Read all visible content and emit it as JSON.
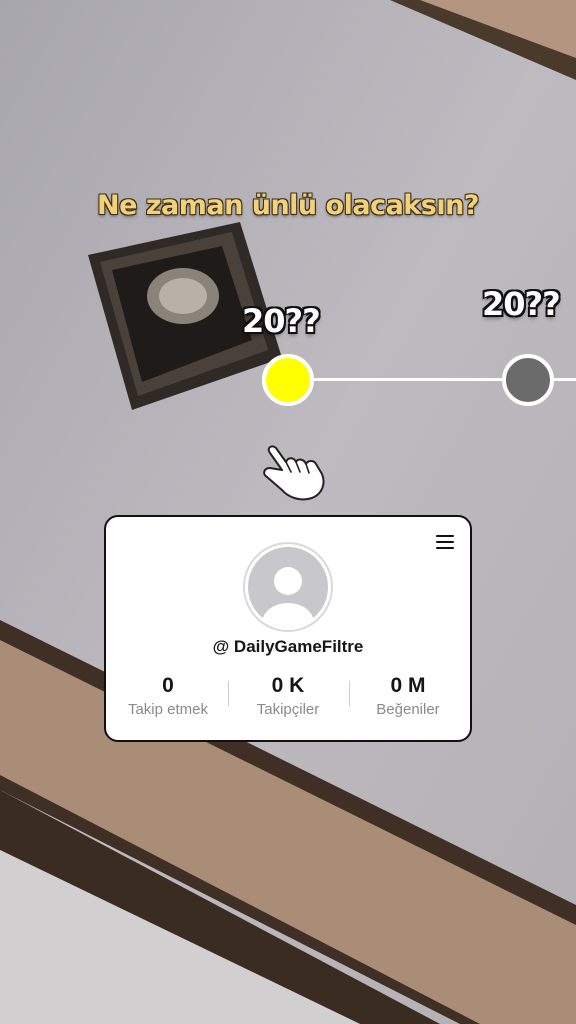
{
  "filter": {
    "question": "Ne zaman ünlü olacaksın?",
    "options": [
      {
        "label": "20??",
        "color": "#ffff00",
        "selected": true
      },
      {
        "label": "20??",
        "color": "#6b6b6b",
        "selected": false
      }
    ]
  },
  "profile_card": {
    "username": "@ DailyGameFiltre",
    "stats": [
      {
        "value": "0",
        "label": "Takip etmek"
      },
      {
        "value": "0 K",
        "label": "Takipçiler"
      },
      {
        "value": "0 M",
        "label": "Beğeniler"
      }
    ]
  }
}
